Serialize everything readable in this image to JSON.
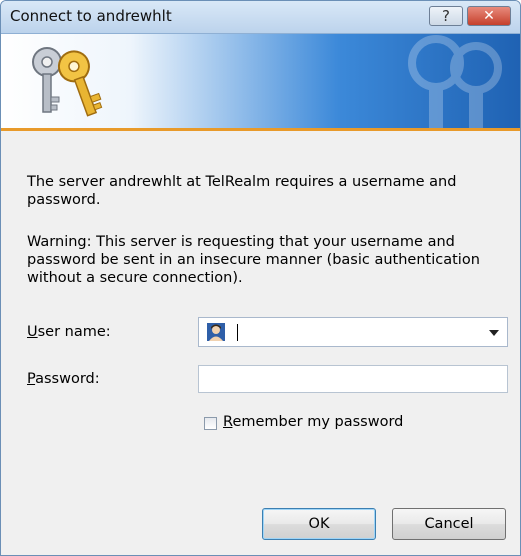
{
  "window": {
    "title": "Connect to andrewhlt",
    "help_label": "?",
    "close_label": "✕"
  },
  "banner": {
    "icon": "keys-icon"
  },
  "message": {
    "line1": "The server andrewhlt   at TelRealm requires a username and password.",
    "warning": "Warning: This server is requesting that your username and password be sent in an insecure manner (basic authentication without a secure connection)."
  },
  "form": {
    "username_label_underline": "U",
    "username_label_rest": "ser name:",
    "username_value": "",
    "password_label_underline": "P",
    "password_label_rest": "assword:",
    "password_value": "",
    "remember_label_underline": "R",
    "remember_label_rest": "emember my password",
    "remember_checked": false
  },
  "buttons": {
    "ok_label": "OK",
    "cancel_label": "Cancel"
  }
}
